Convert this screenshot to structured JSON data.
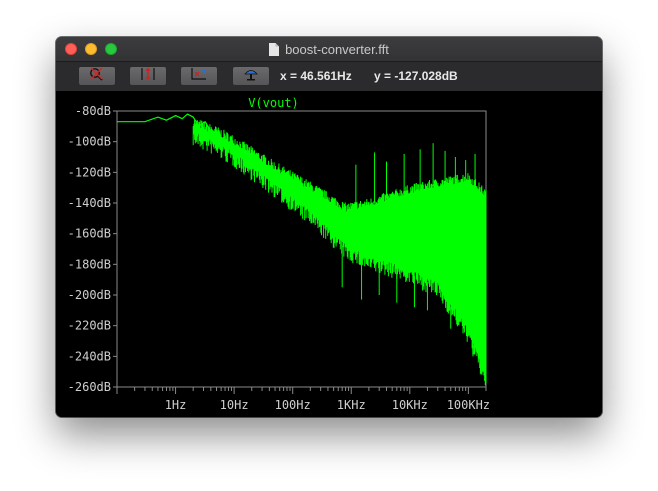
{
  "window": {
    "title": "boost-converter.fft"
  },
  "toolbar": {
    "buttons": [
      {
        "icon": "zoom-cancel-icon"
      },
      {
        "icon": "autorange-y-icon"
      },
      {
        "icon": "zoom-fit-icon"
      },
      {
        "icon": "pan-hand-icon"
      }
    ],
    "x_readout": "x = 46.561Hz",
    "y_readout": "y = -127.028dB"
  },
  "chart_data": {
    "type": "line",
    "title": "V(vout)",
    "x_scale": "log",
    "xlim": [
      0.1,
      200000
    ],
    "ylim": [
      -260,
      -80
    ],
    "x_tick_labels": [
      "1Hz",
      "10Hz",
      "100Hz",
      "1KHz",
      "10KHz",
      "100KHz"
    ],
    "x_tick_values": [
      1,
      10,
      100,
      1000,
      10000,
      100000
    ],
    "y_tick_labels": [
      "-80dB",
      "-100dB",
      "-120dB",
      "-140dB",
      "-160dB",
      "-180dB",
      "-200dB",
      "-220dB",
      "-240dB",
      "-260dB"
    ],
    "y_tick_values": [
      -80,
      -100,
      -120,
      -140,
      -160,
      -180,
      -200,
      -220,
      -240,
      -260
    ],
    "grid": false,
    "series": [
      {
        "color": "#00ff00",
        "points": [
          [
            0.1,
            -87
          ],
          [
            0.3,
            -87
          ],
          [
            0.5,
            -84
          ],
          [
            0.7,
            -86
          ],
          [
            1,
            -83
          ],
          [
            1.3,
            -85
          ],
          [
            1.6,
            -82
          ],
          [
            2,
            -84
          ],
          [
            2.5,
            -90
          ],
          [
            3.2,
            -87
          ],
          [
            4,
            -93
          ],
          [
            5,
            -97
          ],
          [
            7,
            -101
          ],
          [
            10,
            -107
          ],
          [
            20,
            -115
          ],
          [
            46.561,
            -127.028
          ],
          [
            100,
            -135
          ],
          [
            200,
            -142
          ],
          [
            500,
            -150
          ],
          [
            1000,
            -156
          ],
          [
            2000,
            -158
          ],
          [
            5000,
            -157
          ],
          [
            10000,
            -154
          ],
          [
            20000,
            -152
          ],
          [
            50000,
            -155
          ],
          [
            100000,
            -165
          ],
          [
            150000,
            -180
          ],
          [
            200000,
            -190
          ]
        ],
        "envelope_top": [
          [
            2,
            -88
          ],
          [
            5,
            -94
          ],
          [
            10,
            -100
          ],
          [
            50,
            -117
          ],
          [
            200,
            -130
          ],
          [
            800,
            -144
          ],
          [
            2000,
            -141
          ],
          [
            5000,
            -136
          ],
          [
            10000,
            -132
          ],
          [
            30000,
            -128
          ],
          [
            100000,
            -124
          ],
          [
            200000,
            -135
          ]
        ],
        "envelope_bottom": [
          [
            2,
            -96
          ],
          [
            5,
            -103
          ],
          [
            10,
            -110
          ],
          [
            50,
            -130
          ],
          [
            200,
            -148
          ],
          [
            800,
            -170
          ],
          [
            2000,
            -178
          ],
          [
            5000,
            -182
          ],
          [
            10000,
            -186
          ],
          [
            30000,
            -195
          ],
          [
            100000,
            -225
          ],
          [
            200000,
            -255
          ]
        ],
        "spikes": [
          [
            1200,
            -115
          ],
          [
            2500,
            -107
          ],
          [
            4000,
            -113
          ],
          [
            8000,
            -108
          ],
          [
            15000,
            -105
          ],
          [
            25000,
            -101
          ],
          [
            40000,
            -106
          ],
          [
            60000,
            -110
          ],
          [
            90000,
            -112
          ],
          [
            130000,
            -108
          ],
          [
            700,
            -195
          ],
          [
            1500,
            -203
          ],
          [
            3000,
            -200
          ],
          [
            6000,
            -205
          ],
          [
            12000,
            -208
          ],
          [
            20000,
            -210
          ],
          [
            50000,
            -222
          ],
          [
            120000,
            -240
          ],
          [
            170000,
            -252
          ]
        ]
      }
    ]
  }
}
